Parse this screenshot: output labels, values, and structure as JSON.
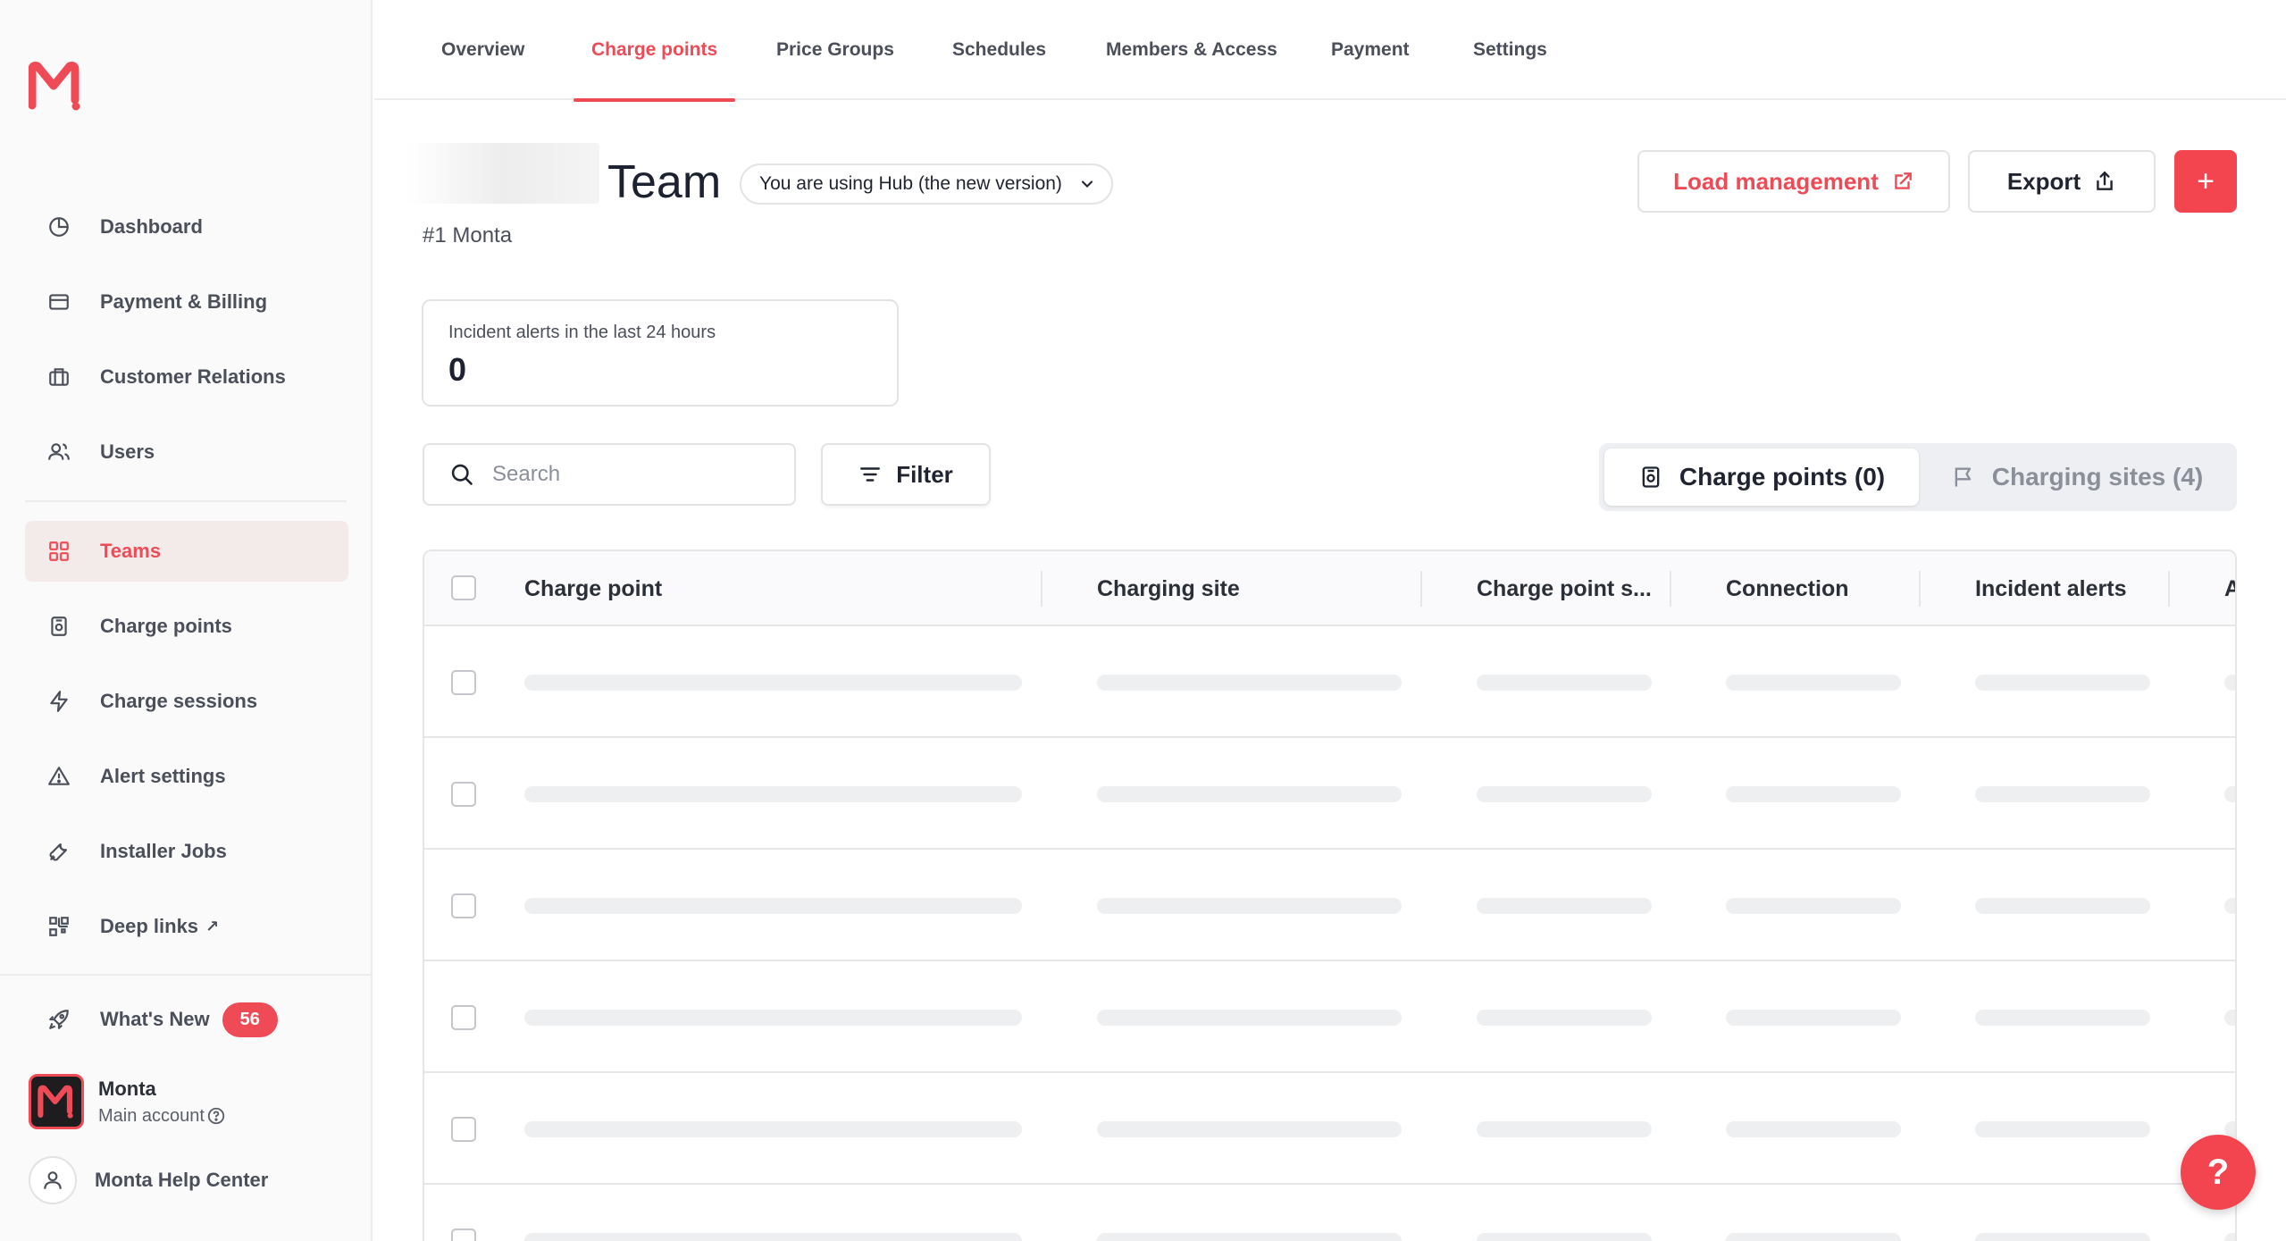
{
  "colors": {
    "accent": "#ef4b56",
    "accent_bg": "#f3ebea",
    "skeleton": "#eeeff1"
  },
  "sidebar": {
    "logo": "monta-logo",
    "items": [
      {
        "label": "Dashboard",
        "icon": "pie-chart-icon"
      },
      {
        "label": "Payment & Billing",
        "icon": "credit-card-icon"
      },
      {
        "label": "Customer Relations",
        "icon": "briefcase-icon"
      },
      {
        "label": "Users",
        "icon": "users-icon"
      },
      {
        "label": "Teams",
        "icon": "grid-icon",
        "active": true
      },
      {
        "label": "Charge points",
        "icon": "charger-icon"
      },
      {
        "label": "Charge sessions",
        "icon": "bolt-icon"
      },
      {
        "label": "Alert settings",
        "icon": "alert-bell-icon"
      },
      {
        "label": "Installer Jobs",
        "icon": "wrench-icon"
      },
      {
        "label": "Deep links",
        "icon": "qr-code-icon",
        "external": "↗"
      }
    ],
    "whats_new": {
      "label": "What's New",
      "badge": "56",
      "icon": "rocket-icon"
    },
    "account": {
      "name": "Monta",
      "sub": "Main account",
      "icon": "help-circle-icon"
    },
    "help_center": {
      "label": "Monta Help Center",
      "icon": "person-icon"
    }
  },
  "tabs": [
    {
      "label": "Overview"
    },
    {
      "label": "Charge points",
      "active": true
    },
    {
      "label": "Price Groups"
    },
    {
      "label": "Schedules"
    },
    {
      "label": "Members & Access"
    },
    {
      "label": "Payment"
    },
    {
      "label": "Settings"
    }
  ],
  "header": {
    "title": "Team",
    "subtitle": "#1 Monta",
    "version_select": "You are using Hub (the new version)",
    "load_management": "Load management",
    "export": "Export",
    "add": "+"
  },
  "incident_card": {
    "title": "Incident alerts in the last 24 hours",
    "value": "0"
  },
  "search": {
    "placeholder": "Search",
    "value": ""
  },
  "filter": {
    "label": "Filter"
  },
  "segments": {
    "charge_points": "Charge points (0)",
    "charging_sites": "Charging sites (4)"
  },
  "table": {
    "columns": [
      "Charge point",
      "Charging site",
      "Charge point s...",
      "Connection",
      "Incident alerts",
      "A"
    ],
    "loading_rows": 6
  },
  "fab": {
    "label": "?"
  }
}
